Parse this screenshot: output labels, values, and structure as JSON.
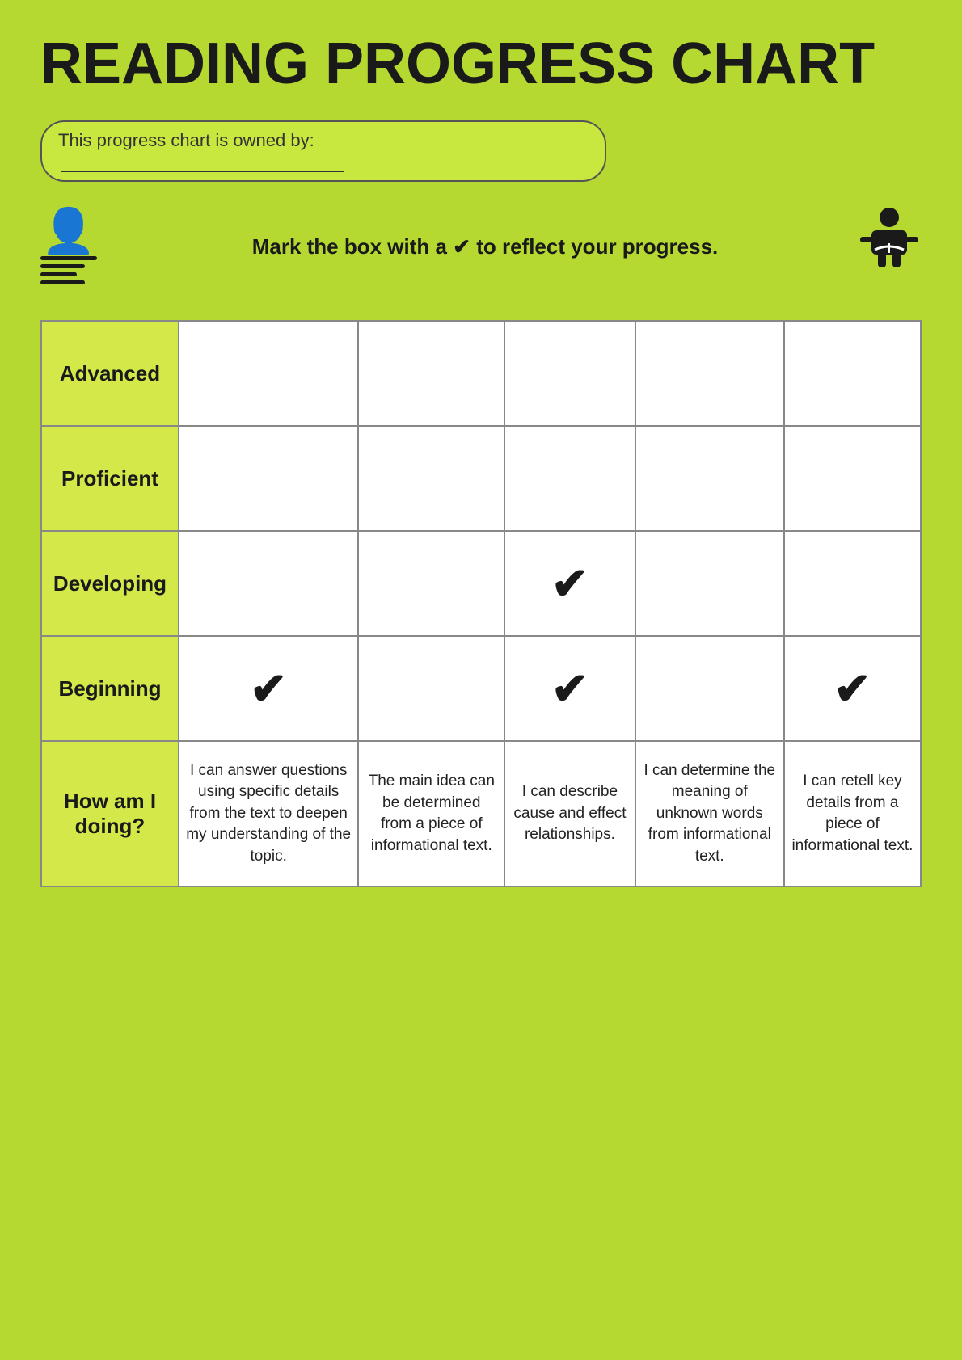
{
  "title": "READING PROGRESS CHART",
  "owner_label": "This progress chart is owned by:",
  "instruction": "Mark the box with a ✔ to reflect your progress.",
  "rows": [
    {
      "label": "Advanced",
      "checks": [
        false,
        false,
        false,
        false,
        false
      ]
    },
    {
      "label": "Proficient",
      "checks": [
        false,
        false,
        false,
        false,
        false
      ]
    },
    {
      "label": "Developing",
      "checks": [
        false,
        false,
        true,
        false,
        false
      ]
    },
    {
      "label": "Beginning",
      "checks": [
        true,
        false,
        true,
        false,
        true
      ]
    },
    {
      "label": "How am I\ndoing?",
      "checks": [
        false,
        false,
        false,
        false,
        false
      ]
    }
  ],
  "descriptions": [
    "I can answer questions using specific details from the text to deepen my understanding of the topic.",
    "The main idea can be determined from a piece of informational text.",
    "I can describe cause and effect relationships.",
    "I can determine the meaning of unknown words from informational text.",
    "I can retell key details from a piece of informational text."
  ],
  "checkmark": "✔",
  "colors": {
    "bg": "#b5d930",
    "cell_label": "#d4e84a",
    "cell_white": "#ffffff",
    "text_dark": "#1a1a1a"
  }
}
